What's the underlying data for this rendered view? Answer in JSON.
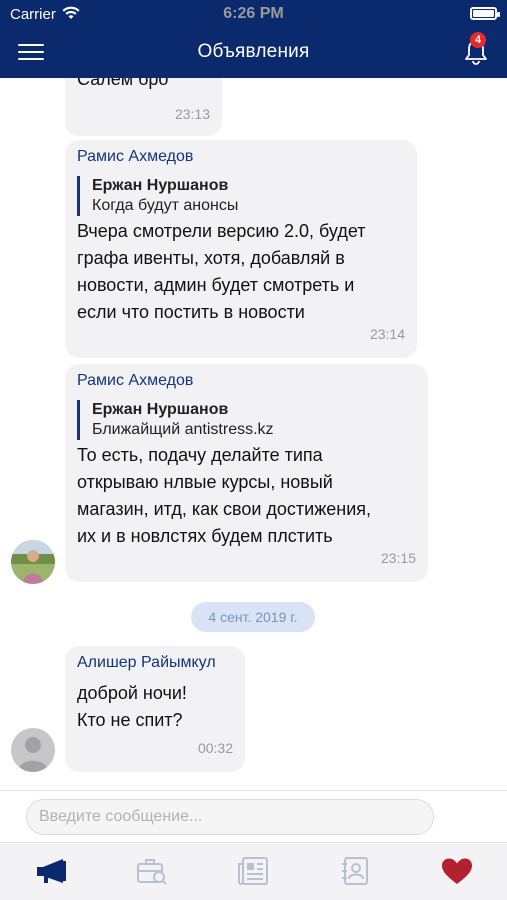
{
  "status": {
    "carrier": "Carrier",
    "time": "6:26 PM"
  },
  "nav": {
    "title": "Объявления",
    "notifications_count": "4"
  },
  "messages": [
    {
      "text": "Салем бро",
      "time": "23:13"
    },
    {
      "sender": "Рамис Ахмедов",
      "quote_name": "Ержан Нуршанов",
      "quote_text": "Когда будут анонсы",
      "text": "Вчера смотрели версию 2.0, будет\nграфа ивенты, хотя, добавляй в\nновости, админ будет смотреть и\nесли что постить в новости",
      "time": "23:14"
    },
    {
      "sender": "Рамис Ахмедов",
      "quote_name": "Ержан Нуршанов",
      "quote_text": "Ближайщий antistress.kz",
      "text": "То есть, подачу делайте типа\nоткрываю нлвые курсы, новый\nмагазин, итд, как свои достижения,\nих и в новлстях будем плстить",
      "time": "23:15"
    },
    {
      "sender": "Алишер Райымкул",
      "text": "доброй ночи!\nКто не спит?",
      "time": "00:32"
    }
  ],
  "date_separator": "4 сент. 2019 г.",
  "composer": {
    "placeholder": "Введите сообщение..."
  },
  "tabs": [
    {
      "icon": "megaphone-icon",
      "active": true
    },
    {
      "icon": "briefcase-search-icon",
      "active": false
    },
    {
      "icon": "newspaper-icon",
      "active": false
    },
    {
      "icon": "contacts-book-icon",
      "active": false
    },
    {
      "icon": "heart-icon",
      "active": false
    }
  ],
  "colors": {
    "brand_blue": "#0b2a6e",
    "badge_red": "#e62a2a",
    "heart_red": "#b3202e",
    "tab_inactive": "#b9c0d0"
  }
}
